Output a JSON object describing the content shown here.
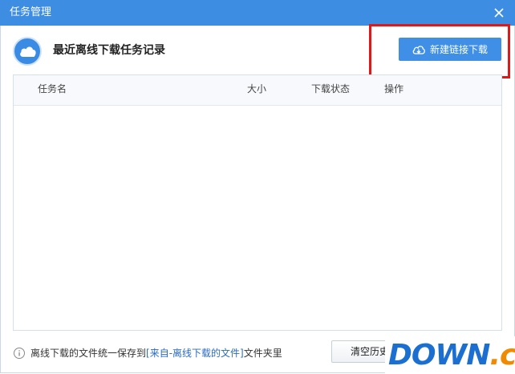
{
  "window": {
    "title": "任务管理"
  },
  "header": {
    "title": "最近离线下载任务记录",
    "new_button_label": "新建链接下载"
  },
  "table": {
    "columns": [
      "任务名",
      "大小",
      "下载状态",
      "操作"
    ],
    "rows": []
  },
  "footer": {
    "info_prefix": "离线下载的文件统一保存到",
    "info_link": "[来自-离线下载的文件]",
    "info_suffix": "文件夹里",
    "clear_button_label": "清空历史"
  },
  "watermark": {
    "main": "DOWN",
    "suffix": ".cc"
  },
  "colors": {
    "titlebar": "#3d8ee3",
    "accent": "#3e8fe5",
    "highlight": "#e01818"
  }
}
